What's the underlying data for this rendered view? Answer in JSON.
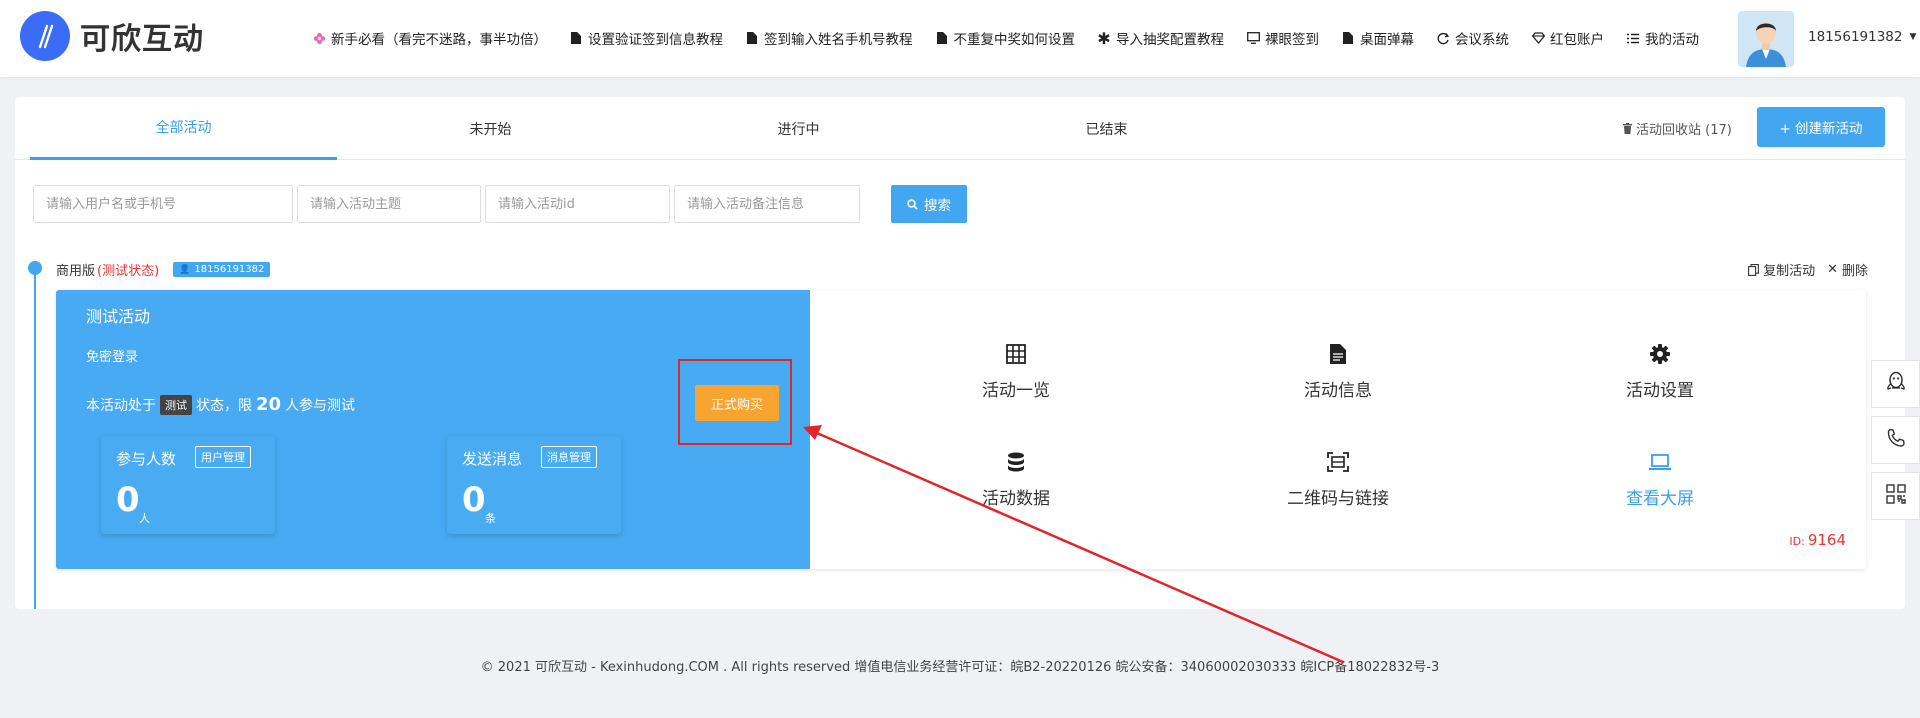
{
  "header": {
    "logo_text": "可欣互动",
    "nav": [
      {
        "icon": "flower-icon",
        "label": "新手必看（看完不迷路，事半功倍）"
      },
      {
        "icon": "document-icon",
        "label": "设置验证签到信息教程"
      },
      {
        "icon": "document-icon",
        "label": "签到输入姓名手机号教程"
      },
      {
        "icon": "document-icon",
        "label": "不重复中奖如何设置"
      },
      {
        "icon": "asterisk-icon",
        "label": "导入抽奖配置教程"
      },
      {
        "icon": "monitor-icon",
        "label": "裸眼签到"
      },
      {
        "icon": "document-icon",
        "label": "桌面弹幕"
      },
      {
        "icon": "cycle-icon",
        "label": "会议系统"
      },
      {
        "icon": "diamond-icon",
        "label": "红包账户"
      },
      {
        "icon": "list-icon",
        "label": "我的活动"
      }
    ],
    "user_phone": "18156191382"
  },
  "tabs": [
    {
      "label": "全部活动",
      "active": true
    },
    {
      "label": "未开始",
      "active": false
    },
    {
      "label": "进行中",
      "active": false
    },
    {
      "label": "已结束",
      "active": false
    }
  ],
  "toolbar": {
    "recycle_label": "活动回收站 (17)",
    "create_label": "+ 创建新活动"
  },
  "search": {
    "user_placeholder": "请输入用户名或手机号",
    "topic_placeholder": "请输入活动主题",
    "id_placeholder": "请输入活动id",
    "note_placeholder": "请输入活动备注信息",
    "button_label": "搜索"
  },
  "activity": {
    "version": "商用版",
    "state": "(测试状态)",
    "user_tag": "18156191382",
    "copy_label": "复制活动",
    "delete_label": "删除",
    "title": "测试活动",
    "login_mode": "免密登录",
    "status_prefix": "本活动处于",
    "status_tag": "测试",
    "status_mid": "状态，限",
    "limit": "20",
    "status_suffix": "人参与测试",
    "buy_label": "正式购买",
    "stats": [
      {
        "label": "参与人数",
        "manage": "用户管理",
        "value": "0",
        "unit": "人"
      },
      {
        "label": "发送消息",
        "manage": "消息管理",
        "value": "0",
        "unit": "条"
      }
    ],
    "functions": [
      {
        "icon": "grid-icon",
        "label": "活动一览"
      },
      {
        "icon": "file-icon",
        "label": "活动信息"
      },
      {
        "icon": "gear-icon",
        "label": "活动设置"
      },
      {
        "icon": "database-icon",
        "label": "活动数据"
      },
      {
        "icon": "qrcode-scan-icon",
        "label": "二维码与链接"
      },
      {
        "icon": "laptop-icon",
        "label": "查看大屏"
      }
    ],
    "id_label": "ID:",
    "id_value": "9164"
  },
  "footer": {
    "text": "© 2021 可欣互动 - Kexinhudong.COM . All rights reserved 增值电信业务经营许可证：皖B2-20220126 皖公安备：34060002030333 皖ICP备18022832号-3"
  },
  "colors": {
    "primary": "#42a7f0",
    "card_blue": "#47aaf2",
    "buy_orange": "#f7a530",
    "highlight_red": "#e0262b"
  }
}
